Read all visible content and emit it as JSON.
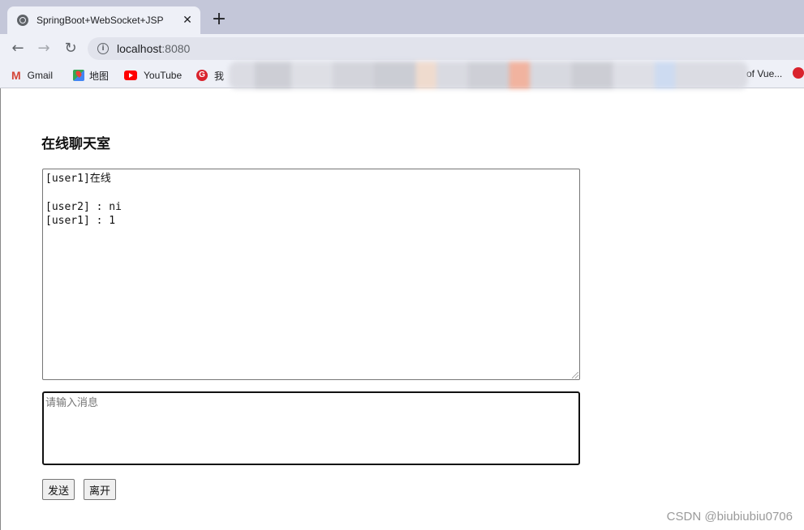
{
  "browser": {
    "tab_title": "SpringBoot+WebSocket+JSP",
    "url_host": "localhost",
    "url_port": ":8080",
    "bookmarks": [
      {
        "label": "Gmail",
        "icon": "gmail-icon"
      },
      {
        "label": "地图",
        "icon": "maps-icon"
      },
      {
        "label": "YouTube",
        "icon": "youtube-icon"
      },
      {
        "label": "我",
        "icon": "red-g-icon"
      }
    ],
    "bookmark_last": "of Vue..."
  },
  "page": {
    "title": "在线聊天室",
    "messages": [
      "[user1]在线",
      "[user2] : ni",
      "",
      "[user1] : 1"
    ],
    "input_placeholder": "请输入消息",
    "send_label": "发送",
    "leave_label": "离开"
  },
  "watermark": "CSDN @biubiubiu0706"
}
